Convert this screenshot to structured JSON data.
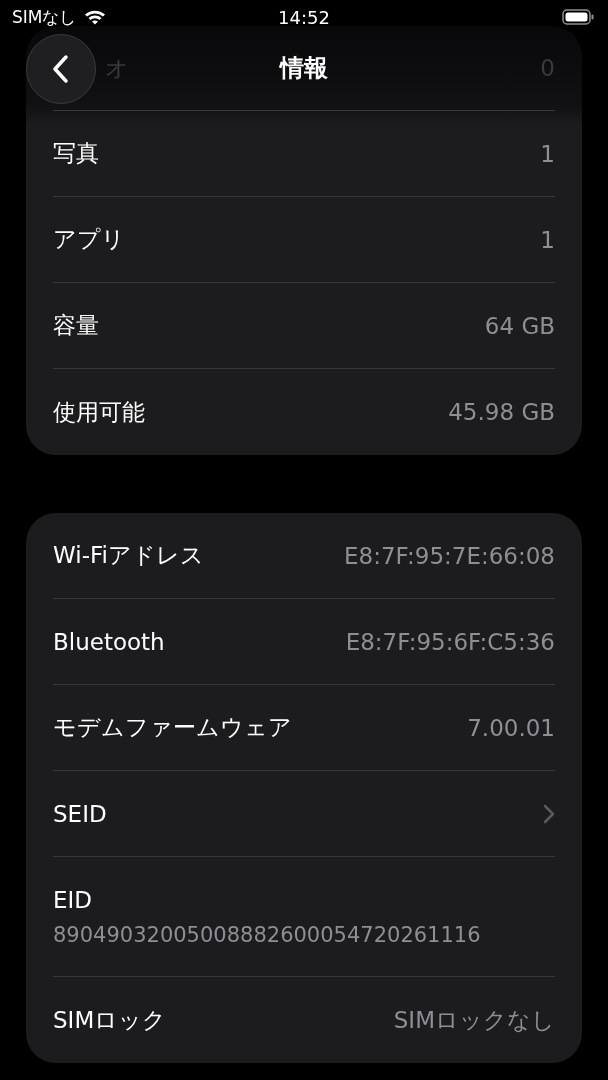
{
  "status_bar": {
    "carrier": "SIMなし",
    "time": "14:52"
  },
  "nav": {
    "title": "情報"
  },
  "storage_rows": [
    {
      "kind": "faded",
      "label": "オ",
      "value": "0"
    },
    {
      "kind": "value",
      "label": "写真",
      "value": "1"
    },
    {
      "kind": "value",
      "label": "アプリ",
      "value": "1"
    },
    {
      "kind": "value",
      "label": "容量",
      "value": "64 GB"
    },
    {
      "kind": "value",
      "label": "使用可能",
      "value": "45.98 GB"
    }
  ],
  "network_rows": [
    {
      "kind": "value",
      "label": "Wi-Fiアドレス",
      "value": "E8:7F:95:7E:66:08"
    },
    {
      "kind": "value",
      "label": "Bluetooth",
      "value": "E8:7F:95:6F:C5:36"
    },
    {
      "kind": "value",
      "label": "モデムファームウェア",
      "value": "7.00.01"
    },
    {
      "kind": "link",
      "label": "SEID"
    },
    {
      "kind": "stacked",
      "label": "EID",
      "value": "89049032005008882600054720261116"
    },
    {
      "kind": "value",
      "label": "SIMロック",
      "value": "SIMロックなし"
    }
  ]
}
